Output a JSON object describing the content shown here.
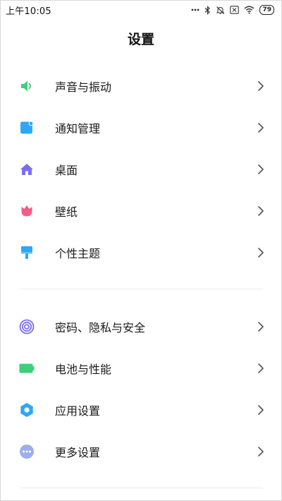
{
  "status_bar": {
    "time": "上午10:05",
    "battery_level": "79"
  },
  "header": {
    "title": "设置"
  },
  "groups": [
    {
      "items": [
        {
          "label": "声音与振动",
          "icon": "speaker-icon",
          "color": "#3ccf7c"
        },
        {
          "label": "通知管理",
          "icon": "notification-icon",
          "color": "#2ea8f5"
        },
        {
          "label": "桌面",
          "icon": "home-icon",
          "color": "#7b6ef0"
        },
        {
          "label": "壁纸",
          "icon": "tulip-icon",
          "color": "#f25c87"
        },
        {
          "label": "个性主题",
          "icon": "paint-brush-icon",
          "color": "#2ea8f5"
        }
      ]
    },
    {
      "items": [
        {
          "label": "密码、隐私与安全",
          "icon": "fingerprint-icon",
          "color": "#7b6ef0"
        },
        {
          "label": "电池与性能",
          "icon": "battery-icon",
          "color": "#3ccf7c"
        },
        {
          "label": "应用设置",
          "icon": "gear-icon",
          "color": "#2ea8f5"
        },
        {
          "label": "更多设置",
          "icon": "more-dots-icon",
          "color": "#9bb0e8"
        }
      ]
    }
  ]
}
